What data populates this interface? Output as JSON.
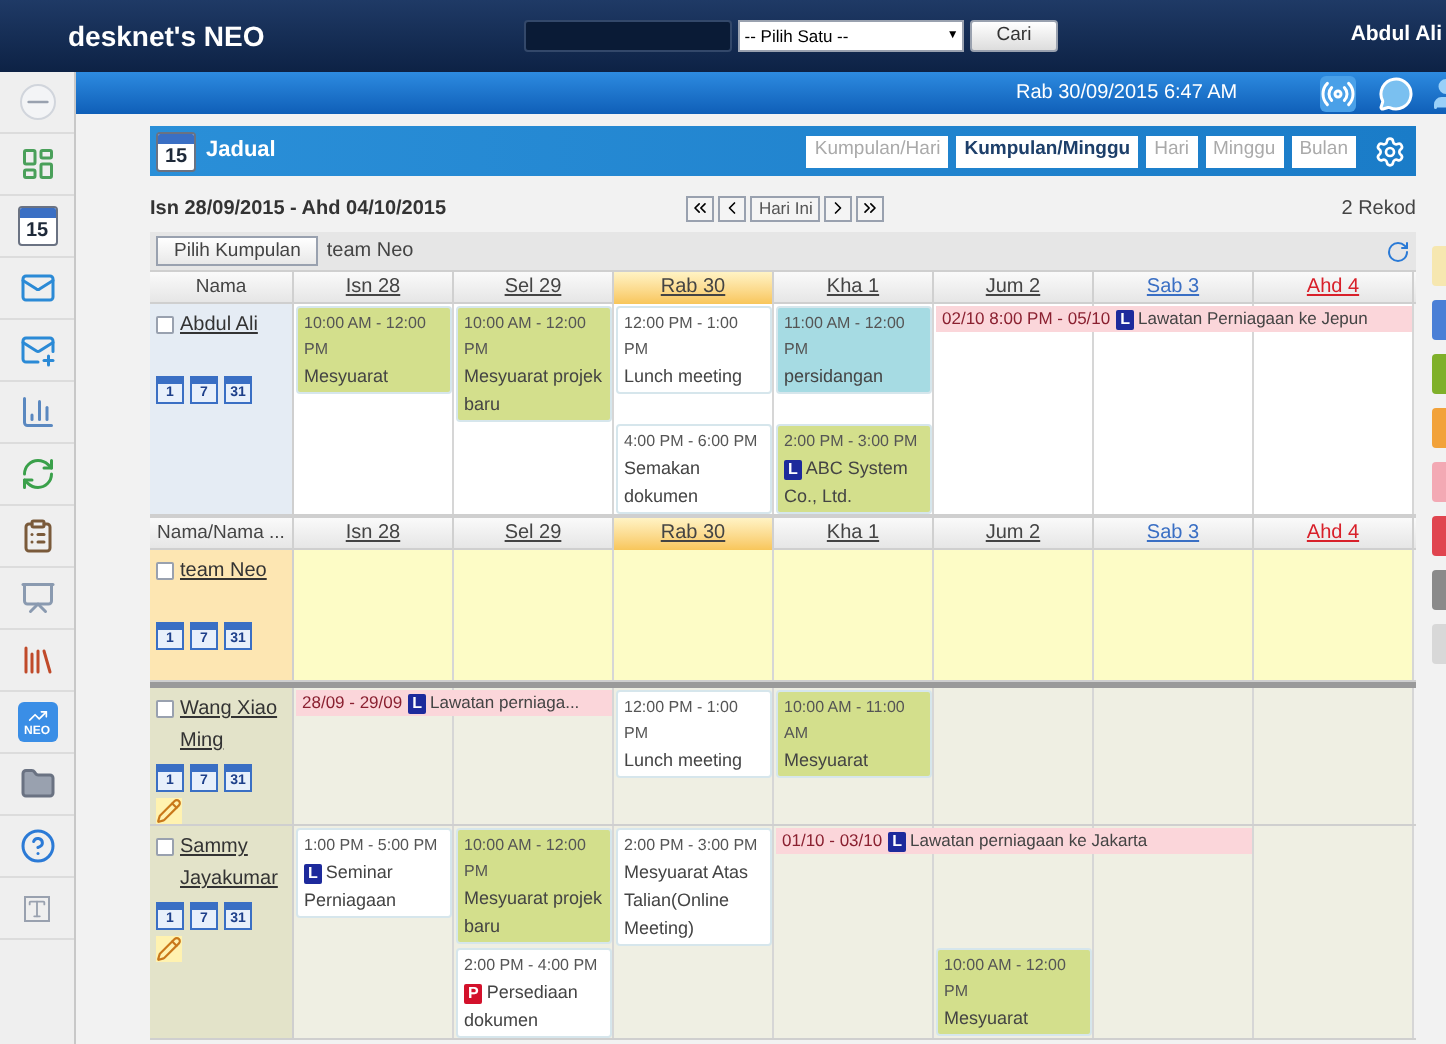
{
  "header": {
    "logo": "desknet's NEO",
    "search_select": "-- Pilih Satu --",
    "select_arrow": "▼",
    "search_button": "Cari",
    "user": "Abdul Ali"
  },
  "subheader": {
    "datetime": "Rab 30/09/2015 6:47 AM"
  },
  "sidebar": {
    "calendar_day": "15",
    "neo_label": "NEO"
  },
  "panel": {
    "title": "Jadual",
    "icon_day": "15",
    "view_tabs": [
      {
        "label": "Kumpulan/Hari",
        "selected": false
      },
      {
        "label": "Kumpulan/Minggu",
        "selected": true
      },
      {
        "label": "Hari",
        "selected": false
      },
      {
        "label": "Minggu",
        "selected": false
      },
      {
        "label": "Bulan",
        "selected": false
      }
    ],
    "date_range": "Isn 28/09/2015 - Ahd 04/10/2015",
    "nav": {
      "today": "Hari Ini"
    },
    "record_count": "2 Rekod",
    "group_button": "Pilih Kumpulan",
    "group_name": "team Neo",
    "sections": [
      {
        "name_header": "Nama",
        "days": [
          {
            "label": "Isn 28",
            "kind": "weekday",
            "selected": false
          },
          {
            "label": "Sel 29",
            "kind": "weekday",
            "selected": false
          },
          {
            "label": "Rab 30",
            "kind": "weekday",
            "selected": true
          },
          {
            "label": "Kha 1",
            "kind": "weekday",
            "selected": false
          },
          {
            "label": "Jum 2",
            "kind": "weekday",
            "selected": false
          },
          {
            "label": "Sab 3",
            "kind": "saturday",
            "selected": false
          },
          {
            "label": "Ahd 4",
            "kind": "sunday",
            "selected": false
          }
        ],
        "rows": [
          {
            "name": "Abdul Ali",
            "kind": "self",
            "checked": false,
            "memo": false,
            "view_icons": [
              "1",
              "7",
              "31"
            ],
            "cells": [
              [
                {
                  "kind": "timed",
                  "time": "10:00 AM - 12:00 PM",
                  "title": "Mesyuarat",
                  "color": "#d3df8c"
                }
              ],
              [
                {
                  "kind": "timed",
                  "time": "10:00 AM - 12:00 PM",
                  "title": "Mesyuarat projek baru",
                  "color": "#d3df8c"
                }
              ],
              [
                {
                  "kind": "timed",
                  "time": "12:00 PM - 1:00 PM",
                  "title": "Lunch meeting",
                  "color": "#ffffff"
                },
                {
                  "kind": "timed",
                  "time": "4:00 PM - 6:00 PM",
                  "title": "Semakan dokumen",
                  "color": "#ffffff"
                }
              ],
              [
                {
                  "kind": "timed",
                  "time": "11:00 AM - 12:00 PM",
                  "title": "persidangan",
                  "color": "#a6dbe3"
                },
                {
                  "kind": "timed",
                  "time": "2:00 PM - 3:00 PM",
                  "badge": {
                    "letter": "L",
                    "color": "#1d2a9c"
                  },
                  "title": "ABC System Co., Ltd.",
                  "color": "#d3df8c"
                }
              ],
              [
                {
                  "kind": "range",
                  "time": "02/10 8:00 PM - 05/10",
                  "badge": {
                    "letter": "L",
                    "color": "#1d2a9c"
                  },
                  "title": "Lawatan Perniagaan ke Jepun",
                  "color": "#fbd6da"
                }
              ],
              [
                {
                  "kind": "continuation"
                }
              ],
              [
                {
                  "kind": "continuation"
                }
              ]
            ]
          }
        ]
      },
      {
        "name_header": "Nama/Nama ...",
        "days": [
          {
            "label": "Isn 28",
            "kind": "weekday",
            "selected": false
          },
          {
            "label": "Sel 29",
            "kind": "weekday",
            "selected": false
          },
          {
            "label": "Rab 30",
            "kind": "weekday",
            "selected": true
          },
          {
            "label": "Kha 1",
            "kind": "weekday",
            "selected": false
          },
          {
            "label": "Jum 2",
            "kind": "weekday",
            "selected": false
          },
          {
            "label": "Sab 3",
            "kind": "saturday",
            "selected": false
          },
          {
            "label": "Ahd 4",
            "kind": "sunday",
            "selected": false
          }
        ],
        "rows": [
          {
            "name": "team Neo",
            "kind": "group",
            "checked": false,
            "memo": false,
            "view_icons": [
              "1",
              "7",
              "31"
            ],
            "cells": [
              [],
              [],
              [],
              [],
              [],
              [],
              []
            ]
          },
          {
            "name": "Wang Xiao Ming",
            "kind": "member",
            "checked": false,
            "memo": true,
            "view_icons": [
              "1",
              "7",
              "31"
            ],
            "cells": [
              [
                {
                  "kind": "range",
                  "time": "28/09 - 29/09",
                  "badge": {
                    "letter": "L",
                    "color": "#1d2a9c"
                  },
                  "title": "Lawatan perniaga...",
                  "color": "#fbd6da"
                }
              ],
              [
                {
                  "kind": "continuation"
                }
              ],
              [
                {
                  "kind": "timed",
                  "time": "12:00 PM - 1:00 PM",
                  "title": "Lunch meeting",
                  "color": "#ffffff"
                }
              ],
              [
                {
                  "kind": "timed",
                  "time": "10:00 AM - 11:00 AM",
                  "title": "Mesyuarat",
                  "color": "#d3df8c"
                }
              ],
              [],
              [],
              []
            ]
          },
          {
            "name": "Sammy Jayakumar",
            "kind": "member",
            "checked": false,
            "memo": true,
            "view_icons": [
              "1",
              "7",
              "31"
            ],
            "cells": [
              [
                {
                  "kind": "timed",
                  "time": "1:00 PM - 5:00 PM",
                  "badge": {
                    "letter": "L",
                    "color": "#1d2a9c"
                  },
                  "title": "Seminar Perniagaan",
                  "color": "#ffffff"
                }
              ],
              [
                {
                  "kind": "timed",
                  "time": "10:00 AM - 12:00 PM",
                  "title": "Mesyuarat projek baru",
                  "color": "#d3df8c"
                },
                {
                  "kind": "timed",
                  "time": "2:00 PM - 4:00 PM",
                  "badge": {
                    "letter": "P",
                    "color": "#d3112b"
                  },
                  "title": "Persediaan dokumen",
                  "color": "#ffffff"
                }
              ],
              [
                {
                  "kind": "timed",
                  "time": "2:00 PM - 3:00 PM",
                  "title": "Mesyuarat Atas Talian(Online Meeting)",
                  "color": "#ffffff"
                }
              ],
              [
                {
                  "kind": "range",
                  "time": "01/10 - 03/10",
                  "badge": {
                    "letter": "L",
                    "color": "#1d2a9c"
                  },
                  "title": "Lawatan perniagaan ke Jakarta",
                  "color": "#fbd6da"
                }
              ],
              [
                {
                  "kind": "continuation"
                },
                {
                  "kind": "timed",
                  "time": "10:00 AM - 12:00 PM",
                  "title": "Mesyuarat",
                  "color": "#d3df8c"
                }
              ],
              [
                {
                  "kind": "continuation"
                }
              ],
              []
            ]
          }
        ]
      }
    ]
  },
  "side_tabs": [
    {
      "color": "#f6e7b0"
    },
    {
      "color": "#4a7fd6"
    },
    {
      "color": "#7fb02a"
    },
    {
      "color": "#f2a23a"
    },
    {
      "color": "#f3a9b4"
    },
    {
      "color": "#e0454f"
    },
    {
      "color": "#8a8a8a"
    },
    {
      "color": "#d8d8d8"
    }
  ]
}
